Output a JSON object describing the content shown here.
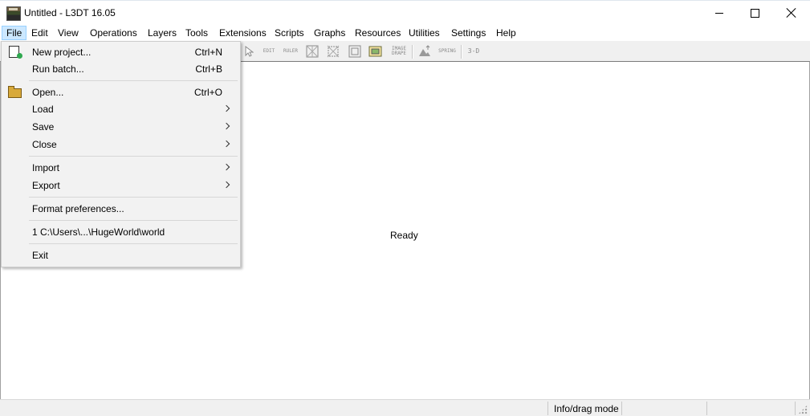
{
  "window": {
    "title": "Untitled - L3DT 16.05"
  },
  "menubar": {
    "items": [
      "File",
      "Edit",
      "View",
      "Operations",
      "Layers",
      "Tools",
      "Extensions",
      "Scripts",
      "Graphs",
      "Resources",
      "Utilities",
      "Settings",
      "Help"
    ]
  },
  "toolbar": {
    "edit_icon_label": "EDIT",
    "ruler_icon_label": "RULER",
    "image_drape_label": "IMAGE DRAPE",
    "spring_label": "SPRING",
    "threed_label": "3-D"
  },
  "file_menu": {
    "new_project": "New project...",
    "new_project_shortcut": "Ctrl+N",
    "run_batch": "Run batch...",
    "run_batch_shortcut": "Ctrl+B",
    "open": "Open...",
    "open_shortcut": "Ctrl+O",
    "load": "Load",
    "save": "Save",
    "close": "Close",
    "import": "Import",
    "export": "Export",
    "format_preferences": "Format preferences...",
    "recent_file": "1 C:\\Users\\...\\HugeWorld\\world",
    "exit": "Exit"
  },
  "main": {
    "status_message": "Ready"
  },
  "statusbar": {
    "mode": "Info/drag mode"
  }
}
